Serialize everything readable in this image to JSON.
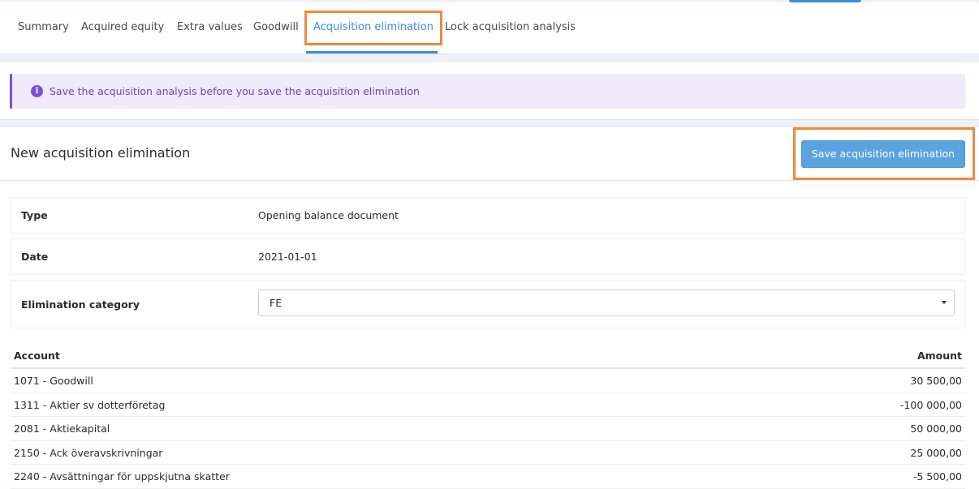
{
  "tabs": [
    {
      "label": "Summary",
      "active": false
    },
    {
      "label": "Acquired equity",
      "active": false
    },
    {
      "label": "Extra values",
      "active": false
    },
    {
      "label": "Goodwill",
      "active": false
    },
    {
      "label": "Acquisition elimination",
      "active": true
    },
    {
      "label": "Lock acquisition analysis",
      "active": false
    }
  ],
  "alert": {
    "icon": "info-icon",
    "text": "Save the acquisition analysis before you save the acquisition elimination"
  },
  "card": {
    "title": "New acquisition elimination",
    "save_label": "Save acquisition elimination"
  },
  "fields": {
    "type": {
      "label": "Type",
      "value": "Opening balance document"
    },
    "date": {
      "label": "Date",
      "value": "2021-01-01"
    },
    "category": {
      "label": "Elimination category",
      "value": "FE"
    }
  },
  "table": {
    "headers": {
      "account": "Account",
      "amount": "Amount"
    },
    "rows": [
      {
        "account": "1071 - Goodwill",
        "amount": "30 500,00"
      },
      {
        "account": "1311 - Aktier sv dotterföretag",
        "amount": "-100 000,00"
      },
      {
        "account": "2081 - Aktiekapital",
        "amount": "50 000,00"
      },
      {
        "account": "2150 - Ack överavskrivningar",
        "amount": "25 000,00"
      },
      {
        "account": "2240 - Avsättningar för uppskjutna skatter",
        "amount": "-5 500,00"
      }
    ]
  },
  "colors": {
    "accent": "#3b8fd6",
    "button": "#5aa3df",
    "alert_bg": "#efebfb",
    "alert_text": "#6a42c8",
    "highlight": "#ef8a3d"
  }
}
